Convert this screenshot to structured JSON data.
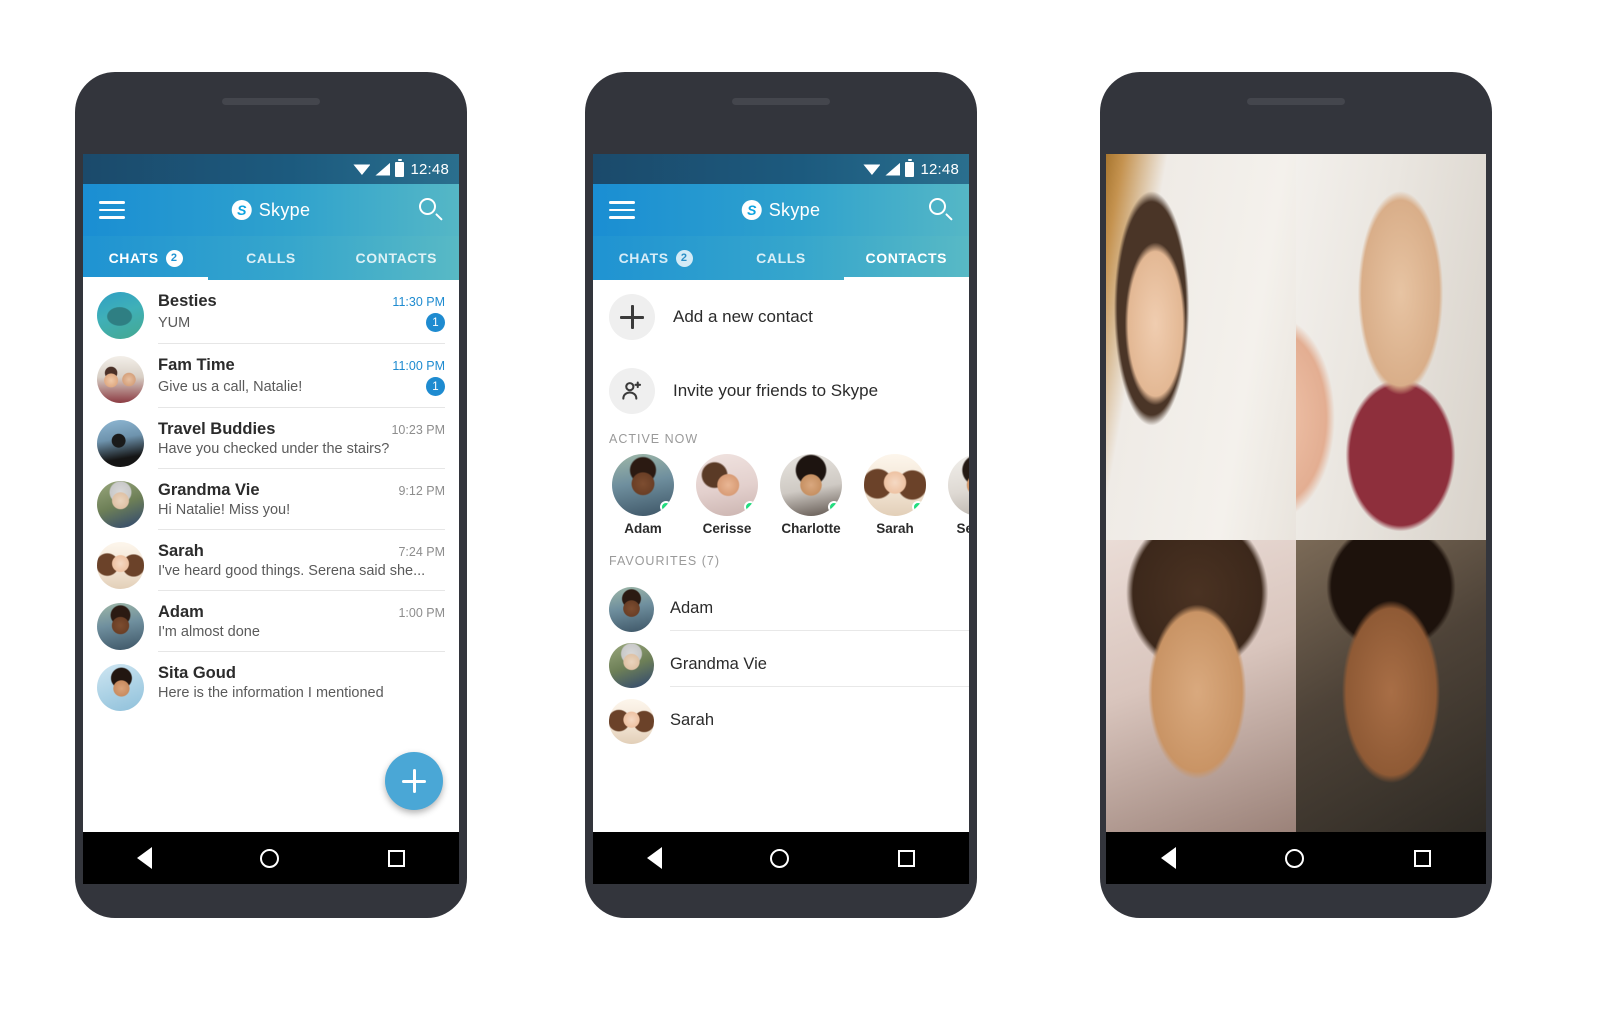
{
  "status_bar": {
    "time": "12:48",
    "icons": [
      "wifi-icon",
      "signal-icon",
      "battery-icon"
    ]
  },
  "app": {
    "brand_name": "Skype",
    "logo_letter": "S",
    "menu_icon": "hamburger-menu-icon",
    "search_icon": "search-icon"
  },
  "tabs": [
    {
      "label": "CHATS",
      "badge": "2",
      "active_phone1": true,
      "active_phone2": false
    },
    {
      "label": "CALLS",
      "badge": "",
      "active_phone1": false,
      "active_phone2": false
    },
    {
      "label": "CONTACTS",
      "badge": "",
      "active_phone1": false,
      "active_phone2": true
    }
  ],
  "phone1": {
    "screen_name": "chats-screen",
    "chats": [
      {
        "name": "Besties",
        "message": "YUM",
        "time": "11:30 PM",
        "unread": "1",
        "avatar": "ph-fish"
      },
      {
        "name": "Fam Time",
        "message": "Give us a call, Natalie!",
        "time": "11:00 PM",
        "unread": "1",
        "avatar": "ph-famtime"
      },
      {
        "name": "Travel Buddies",
        "message": "Have you checked under the stairs?",
        "time": "10:23 PM",
        "unread": "",
        "avatar": "ph-travel"
      },
      {
        "name": "Grandma Vie",
        "message": "Hi Natalie! Miss you!",
        "time": "9:12 PM",
        "unread": "",
        "avatar": "ph-grandma"
      },
      {
        "name": "Sarah",
        "message": "I've heard good things. Serena said she...",
        "time": "7:24 PM",
        "unread": "",
        "avatar": "ph-sarah"
      },
      {
        "name": "Adam",
        "message": "I'm almost done",
        "time": "1:00 PM",
        "unread": "",
        "avatar": "ph-adam"
      },
      {
        "name": "Sita Goud",
        "message": "Here is the information I mentioned",
        "time": "",
        "unread": "",
        "avatar": "ph-sita"
      }
    ],
    "fab": {
      "icon": "plus-icon",
      "color": "#4aa7d6"
    }
  },
  "phone2": {
    "screen_name": "contacts-screen",
    "actions": [
      {
        "label": "Add a new contact",
        "icon": "plus-icon"
      },
      {
        "label": "Invite your friends to Skype",
        "icon": "person-add-icon"
      }
    ],
    "active_now": {
      "header": "ACTIVE NOW",
      "people": [
        {
          "name": "Adam",
          "avatar": "ph-adam",
          "online": true
        },
        {
          "name": "Cerisse",
          "avatar": "ph-cerisse",
          "online": true
        },
        {
          "name": "Charlotte",
          "avatar": "ph-charlotte",
          "online": true
        },
        {
          "name": "Sarah",
          "avatar": "ph-sarah",
          "online": true
        },
        {
          "name": "Serena",
          "avatar": "ph-serena",
          "online": true
        }
      ]
    },
    "favourites": {
      "header": "FAVOURITES (7)",
      "people": [
        {
          "name": "Adam",
          "avatar": "ph-adam"
        },
        {
          "name": "Grandma Vie",
          "avatar": "ph-grandma"
        },
        {
          "name": "Sarah",
          "avatar": "ph-sarah"
        }
      ]
    }
  },
  "phone3": {
    "screen_name": "video-call-screen",
    "tiles": [
      {
        "participant": "woman-waving-left",
        "style": "vid-woman1"
      },
      {
        "participant": "man-waving-right",
        "style": "vid-man1"
      },
      {
        "participant": "woman-smiling",
        "style": "vid-woman2"
      },
      {
        "participant": "man-smiling",
        "style": "vid-man2"
      }
    ]
  },
  "nav_bar": {
    "back_label": "back-button",
    "home_label": "home-button",
    "recents_label": "recents-button"
  },
  "theme": {
    "header_start": "#1a8ed3",
    "header_end": "#55b7c6",
    "accent_blue": "#1e8bd0",
    "fab_blue": "#4aa7d6",
    "online_green": "#22dd7f",
    "bezel": "#33353c"
  }
}
